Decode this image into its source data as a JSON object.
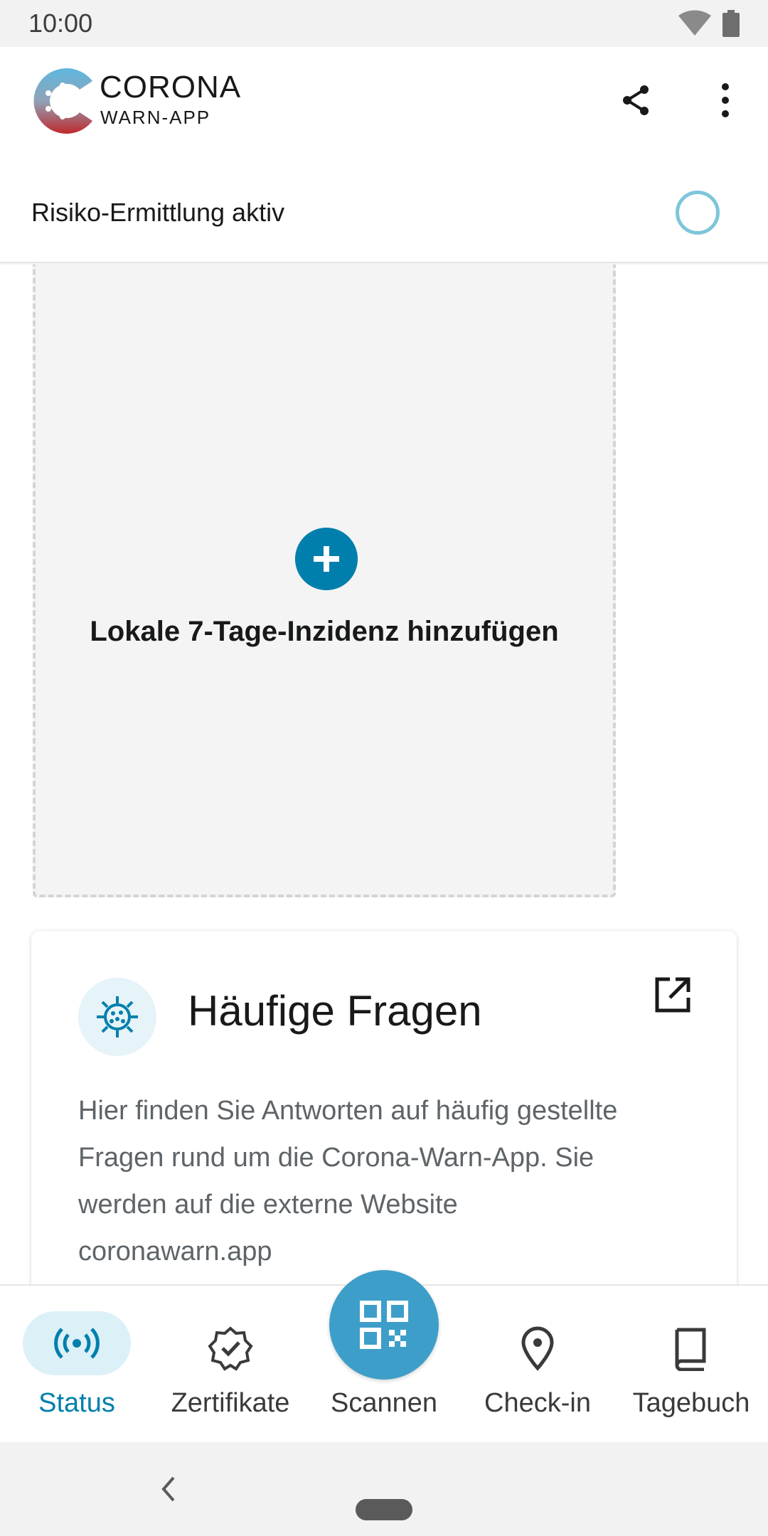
{
  "status_bar": {
    "time": "10:00"
  },
  "header": {
    "logo_title": "CORONA",
    "logo_subtitle": "WARN-APP",
    "risk_label": "Risiko-Ermittlung aktiv"
  },
  "incidence_card": {
    "label": "Lokale 7-Tage-Inzidenz hinzufügen"
  },
  "faq_card": {
    "title": "Häufige Fragen",
    "body": "Hier finden Sie Antworten auf häufig gestellte Fragen rund um die Corona-Warn-App. Sie werden auf die externe Website coronawarn.app"
  },
  "bottom_nav": {
    "items": [
      {
        "label": "Status",
        "icon": "broadcast-icon",
        "active": true
      },
      {
        "label": "Zertifikate",
        "icon": "certificate-check-icon",
        "active": false
      },
      {
        "label": "Scannen",
        "icon": "qr-code-icon",
        "active": false
      },
      {
        "label": "Check-in",
        "icon": "location-pin-icon",
        "active": false
      },
      {
        "label": "Tagebuch",
        "icon": "book-icon",
        "active": false
      }
    ]
  },
  "colors": {
    "accent": "#007fad",
    "fab": "#3d9ec9",
    "risk_ring": "#7ec6da",
    "active_pill": "#dcf0f7"
  }
}
